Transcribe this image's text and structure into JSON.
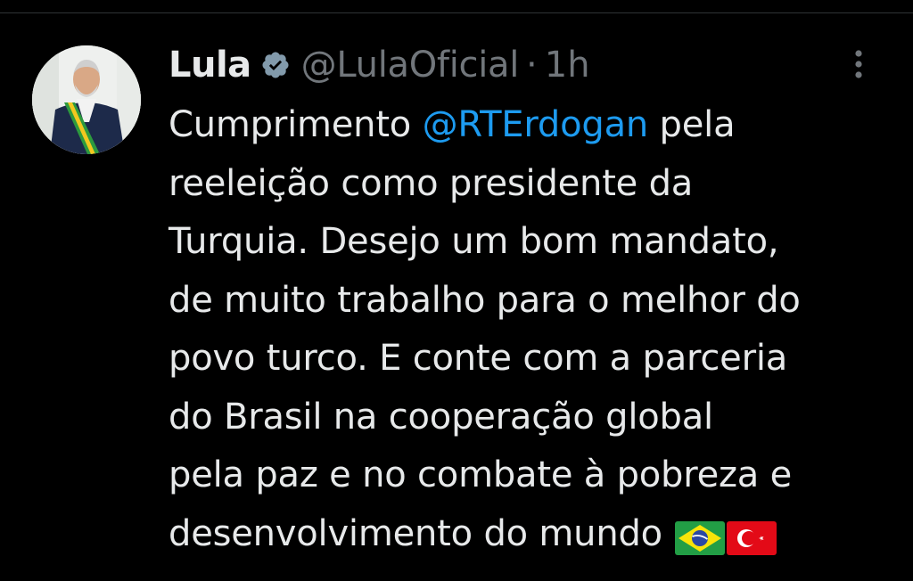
{
  "tweet": {
    "display_name": "Lula",
    "handle": "@LulaOficial",
    "separator": "·",
    "time": "1h",
    "text_lines": [
      {
        "before": "Cumprimento ",
        "mention": "@RTErdogan",
        "after": " pela"
      },
      "reeleição como presidente da",
      "Turquia. Desejo um bom mandato,",
      "de muito trabalho para o melhor do",
      "povo turco. E conte com a parceria",
      "do Brasil na cooperação global",
      "pela paz e no combate à pobreza e",
      "desenvolvimento do mundo"
    ],
    "emojis": [
      "flag-brazil-icon",
      "flag-turkey-icon"
    ]
  },
  "colors": {
    "background": "#000000",
    "text": "#e7e9ea",
    "secondary": "#71767b",
    "link": "#1d9bf0"
  }
}
